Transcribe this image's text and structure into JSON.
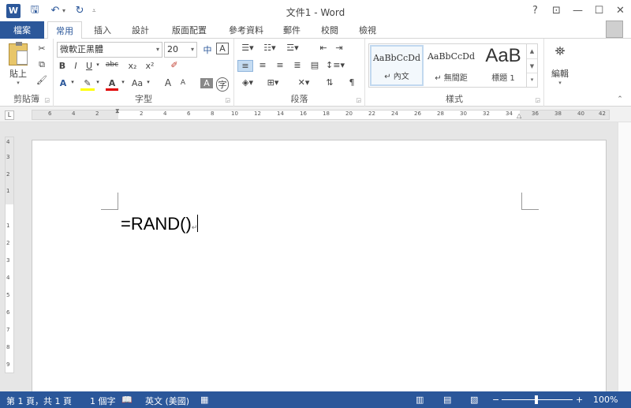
{
  "app": {
    "title": "文件1 - Word",
    "logo_letter": "W"
  },
  "qat": {
    "save_icon": "save-icon",
    "undo_icon": "undo-icon",
    "redo_icon": "redo-icon"
  },
  "window": {
    "help": "?",
    "restore_ribbon": "⊡",
    "minimize": "—",
    "maximize": "☐",
    "close": "✕"
  },
  "tabs": {
    "file": "檔案",
    "items": [
      "常用",
      "插入",
      "設計",
      "版面配置",
      "參考資料",
      "郵件",
      "校閱",
      "檢視"
    ]
  },
  "ribbon": {
    "clipboard": {
      "label": "剪貼簿",
      "paste": "貼上"
    },
    "font": {
      "label": "字型",
      "font_name": "微軟正黑體",
      "font_size": "20",
      "bold": "B",
      "italic": "I",
      "underline": "U",
      "strike": "abc",
      "subscript": "x₂",
      "superscript": "x²",
      "grow": "A",
      "shrink": "A",
      "change_case": "Aa"
    },
    "paragraph": {
      "label": "段落"
    },
    "styles": {
      "label": "樣式",
      "items": [
        {
          "sample": "AaBbCcDd",
          "name": "↵ 內文"
        },
        {
          "sample": "AaBbCcDd",
          "name": "↵ 無間距"
        },
        {
          "sample": "AaB",
          "name": "標題 1"
        }
      ]
    },
    "editing": {
      "label": "編輯"
    }
  },
  "ruler": {
    "corner": "L",
    "marks": [
      "6",
      "4",
      "2",
      "2",
      "4",
      "6",
      "8",
      "10",
      "12",
      "14",
      "16",
      "18",
      "20",
      "22",
      "24",
      "26",
      "28",
      "30",
      "32",
      "34",
      "36",
      "38",
      "40",
      "42"
    ],
    "vmarks": [
      "4",
      "3",
      "2",
      "1",
      "1",
      "2",
      "3",
      "4",
      "5",
      "6",
      "7",
      "8",
      "9"
    ]
  },
  "document": {
    "text": "=RAND()"
  },
  "status": {
    "page": "第 1 頁，共 1 頁",
    "words": "1 個字",
    "language": "英文 (美國)",
    "zoom": "100%",
    "zoom_minus": "−",
    "zoom_plus": "+"
  }
}
